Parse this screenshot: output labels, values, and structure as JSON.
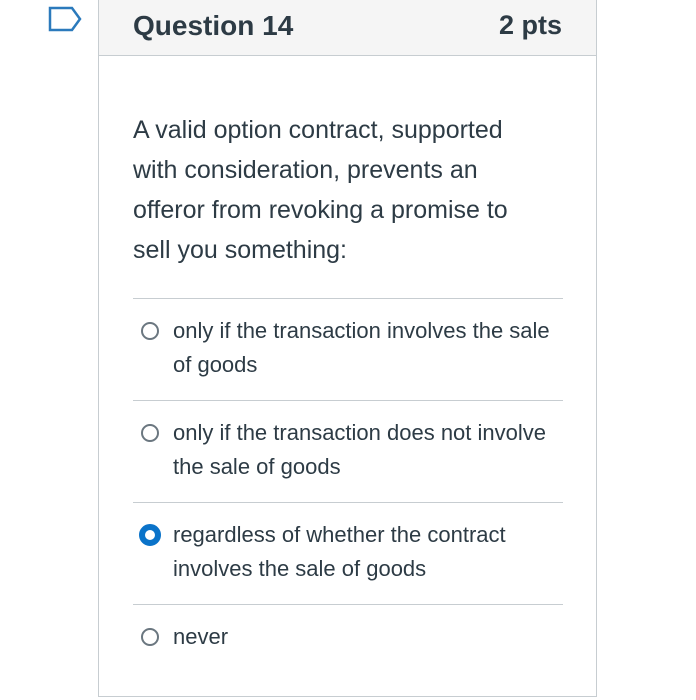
{
  "question": {
    "title": "Question 14",
    "points": "2 pts",
    "text": "A valid option contract, supported with consideration, prevents an offeror from revoking a promise to sell you something:"
  },
  "answers": [
    {
      "label": "only if the transaction involves the sale of goods",
      "selected": false
    },
    {
      "label": "only if the transaction does not involve the sale of goods",
      "selected": false
    },
    {
      "label": "regardless of whether the contract involves the sale of goods",
      "selected": true
    },
    {
      "label": "never",
      "selected": false
    }
  ],
  "colors": {
    "accent": "#0a73c9",
    "flag": "#2b7abc",
    "border": "#c7cdd1",
    "text": "#2d3b45"
  },
  "icons": {
    "flag": "bookmark-flag-icon"
  }
}
